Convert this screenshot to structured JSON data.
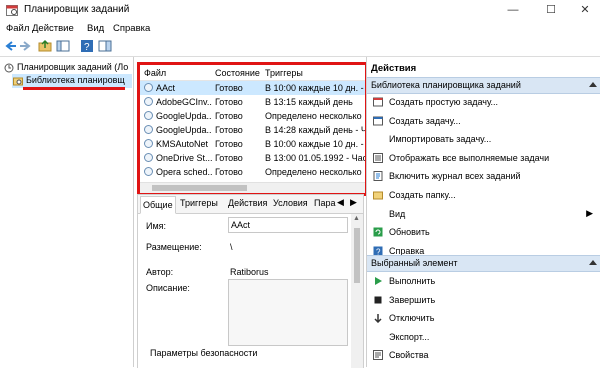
{
  "window": {
    "title": "Планировщик заданий"
  },
  "menu": [
    "Файл",
    "Действие",
    "Вид",
    "Справка"
  ],
  "tree": {
    "root": "Планировщик заданий (Ло",
    "library": "Библиотека планировщ"
  },
  "task_list": {
    "columns": [
      "Файл",
      "Состояние",
      "Триггеры"
    ],
    "rows": [
      {
        "name": "AAct",
        "status": "Готово",
        "trigger": "В 10:00 каждые 10 дн. -"
      },
      {
        "name": "AdobeGCInv...",
        "status": "Готово",
        "trigger": "В 13:15 каждый день"
      },
      {
        "name": "GoogleUpda...",
        "status": "Готово",
        "trigger": "Определено несколько"
      },
      {
        "name": "GoogleUpda...",
        "status": "Готово",
        "trigger": "В 14:28 каждый день - Ч"
      },
      {
        "name": "KMSAutoNet",
        "status": "Готово",
        "trigger": "В 10:00 каждые 10 дн. -"
      },
      {
        "name": "OneDrive St...",
        "status": "Готово",
        "trigger": "В 13:00 01.05.1992 - Част"
      },
      {
        "name": "Opera sched...",
        "status": "Готово",
        "trigger": "Определено несколько"
      }
    ]
  },
  "details": {
    "tabs": [
      "Общие",
      "Триггеры",
      "Действия",
      "Условия",
      "Пара"
    ],
    "name_label": "Имя:",
    "name_value": "AAct",
    "location_label": "Размещение:",
    "location_value": "\\",
    "author_label": "Автор:",
    "author_value": "Ratiborus",
    "description_label": "Описание:",
    "security_label": "Параметры безопасности"
  },
  "actions": {
    "title": "Действия",
    "section1": "Библиотека планировщика заданий",
    "items1": [
      {
        "label": "Создать простую задачу...",
        "icon": "task-wizard-icon"
      },
      {
        "label": "Создать задачу...",
        "icon": "task-icon"
      },
      {
        "label": "Импортировать задачу...",
        "icon": "none"
      },
      {
        "label": "Отображать все выполняемые задачи",
        "icon": "list-icon"
      },
      {
        "label": "Включить журнал всех заданий",
        "icon": "log-icon"
      },
      {
        "label": "Создать папку...",
        "icon": "folder-icon"
      },
      {
        "label": "Вид",
        "icon": "none"
      },
      {
        "label": "Обновить",
        "icon": "refresh-icon"
      },
      {
        "label": "Справка",
        "icon": "help-icon"
      }
    ],
    "section2": "Выбранный элемент",
    "items2": [
      {
        "label": "Выполнить",
        "icon": "play-icon"
      },
      {
        "label": "Завершить",
        "icon": "stop-icon"
      },
      {
        "label": "Отключить",
        "icon": "disable-icon"
      },
      {
        "label": "Экспорт...",
        "icon": "none"
      },
      {
        "label": "Свойства",
        "icon": "properties-icon"
      }
    ]
  },
  "colors": {
    "highlight": "#e01414",
    "section_bg": "#d9e6f4",
    "selection": "#cce8ff"
  }
}
